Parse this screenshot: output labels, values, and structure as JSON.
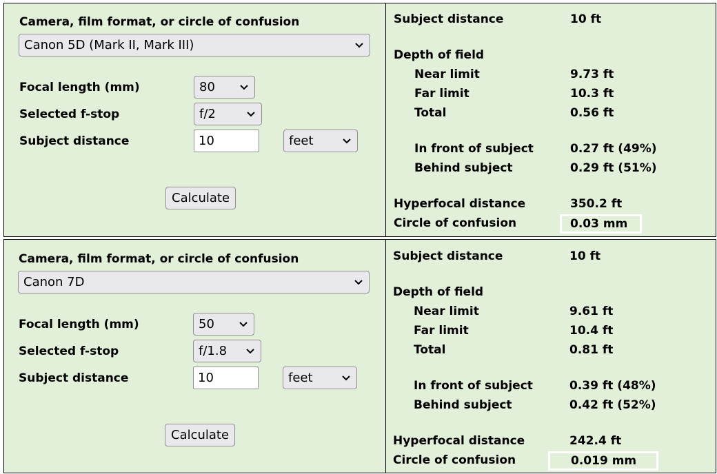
{
  "calculators": [
    {
      "camera_label": "Camera, film format, or circle of confusion",
      "camera_value": "Canon 5D (Mark II, Mark III)",
      "focal_label": "Focal length (mm)",
      "focal_value": "80",
      "fstop_label": "Selected f-stop",
      "fstop_value": "f/2",
      "distance_label": "Subject distance",
      "distance_value": "10",
      "unit_value": "feet",
      "calculate_label": "Calculate",
      "results": {
        "subject_distance_label": "Subject distance",
        "subject_distance_value": "10 ft",
        "dof_label": "Depth of field",
        "near_label": "Near limit",
        "near_value": "9.73 ft",
        "far_label": "Far limit",
        "far_value": "10.3 ft",
        "total_label": "Total",
        "total_value": "0.56 ft",
        "front_label": "In front of subject",
        "front_value": "0.27 ft (49%)",
        "behind_label": "Behind subject",
        "behind_value": "0.29 ft (51%)",
        "hyperfocal_label": "Hyperfocal distance",
        "hyperfocal_value": "350.2 ft",
        "coc_label": "Circle of confusion",
        "coc_value": "0.03 mm"
      }
    },
    {
      "camera_label": "Camera, film format, or circle of confusion",
      "camera_value": "Canon 7D",
      "focal_label": "Focal length (mm)",
      "focal_value": "50",
      "fstop_label": "Selected f-stop",
      "fstop_value": "f/1.8",
      "distance_label": "Subject distance",
      "distance_value": "10",
      "unit_value": "feet",
      "calculate_label": "Calculate",
      "results": {
        "subject_distance_label": "Subject distance",
        "subject_distance_value": "10 ft",
        "dof_label": "Depth of field",
        "near_label": "Near limit",
        "near_value": "9.61 ft",
        "far_label": "Far limit",
        "far_value": "10.4 ft",
        "total_label": "Total",
        "total_value": "0.81 ft",
        "front_label": "In front of subject",
        "front_value": "0.39 ft (48%)",
        "behind_label": "Behind subject",
        "behind_value": "0.42 ft (52%)",
        "hyperfocal_label": "Hyperfocal distance",
        "hyperfocal_value": "242.4 ft",
        "coc_label": "Circle of confusion",
        "coc_value": "0.019 mm"
      }
    }
  ],
  "colors": {
    "panel_background": "#e2efd9",
    "control_background": "#e9e9ed",
    "border": "#000000"
  },
  "icons": {
    "dropdown": "chevron-down-icon"
  }
}
